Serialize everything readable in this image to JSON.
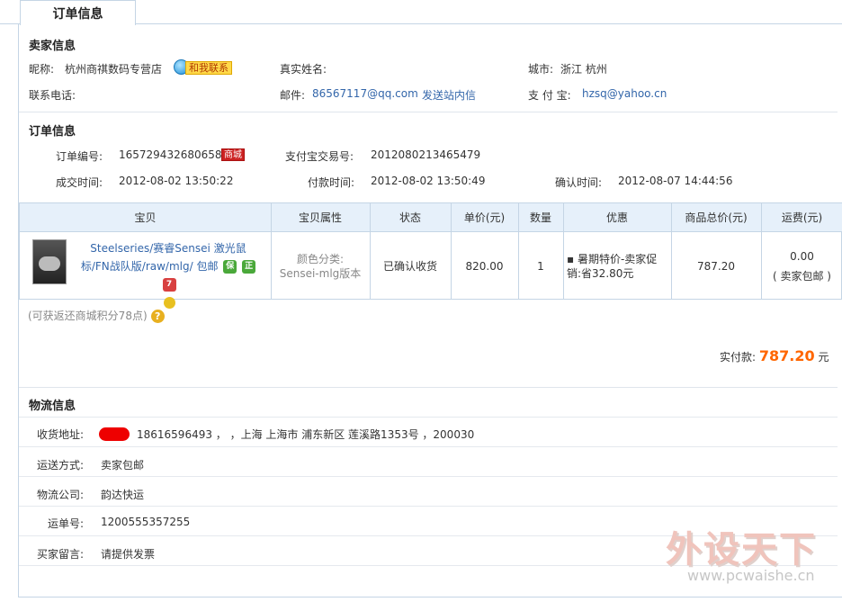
{
  "tab": {
    "label": "订单信息"
  },
  "seller": {
    "title": "卖家信息",
    "nickname_label": "昵称:",
    "nickname": "杭州商祺数码专营店",
    "contact_btn": "和我联系",
    "realname_label": "真实姓名:",
    "city_label": "城市:",
    "city": "浙江 杭州",
    "phone_label": "联系电话:",
    "email_label": "邮件:",
    "email": "86567117@qq.com",
    "send_msg": "发送站内信",
    "alipay_label": "支 付 宝:",
    "alipay": "hzsq@yahoo.cn"
  },
  "order": {
    "title": "订单信息",
    "order_no_label": "订单编号:",
    "order_no": "165729432680658",
    "mall_badge": "商城",
    "trade_no_label": "支付宝交易号:",
    "trade_no": "2012080213465479",
    "deal_time_label": "成交时间:",
    "deal_time": "2012-08-02 13:50:22",
    "pay_time_label": "付款时间:",
    "pay_time": "2012-08-02 13:50:49",
    "confirm_time_label": "确认时间:",
    "confirm_time": "2012-08-07 14:44:56"
  },
  "table": {
    "headers": [
      "宝贝",
      "宝贝属性",
      "状态",
      "单价(元)",
      "数量",
      "优惠",
      "商品总价(元)",
      "运费(元)"
    ],
    "item": {
      "title": "Steelseries/赛睿Sensei 激光鼠标/FN战队版/raw/mlg/ 包邮",
      "icons": [
        "保",
        "正",
        "7"
      ],
      "attr_label": "颜色分类:",
      "attr_value": "Sensei-mlg版本",
      "status": "已确认收货",
      "price": "820.00",
      "qty": "1",
      "discount": "暑期特价-卖家促销:省32.80元",
      "total": "787.20",
      "shipping": "0.00",
      "shipping_note": "( 卖家包邮 )"
    }
  },
  "points_note": "(可获返还商城积分78点)",
  "help_icon": "?",
  "payment": {
    "label": "实付款:",
    "amount": "787.20",
    "unit": "元"
  },
  "logistics": {
    "title": "物流信息",
    "address_label": "收货地址:",
    "address": "18616596493 ， ，上海 上海市 浦东新区 莲溪路1353号 ，200030",
    "ship_method_label": "运送方式:",
    "ship_method": "卖家包邮",
    "company_label": "物流公司:",
    "company": "韵达快运",
    "tracking_label": "运单号:",
    "tracking": "1200555357255",
    "buyer_msg_label": "买家留言:",
    "buyer_msg": "请提供发票"
  },
  "watermark": {
    "big": "外设天下",
    "small": "www.pcwaishe.cn"
  },
  "colors": {
    "accent": "#3366aa",
    "price": "#ff6600",
    "header_bg": "#e6f0fa",
    "border": "#c5d5e5"
  }
}
